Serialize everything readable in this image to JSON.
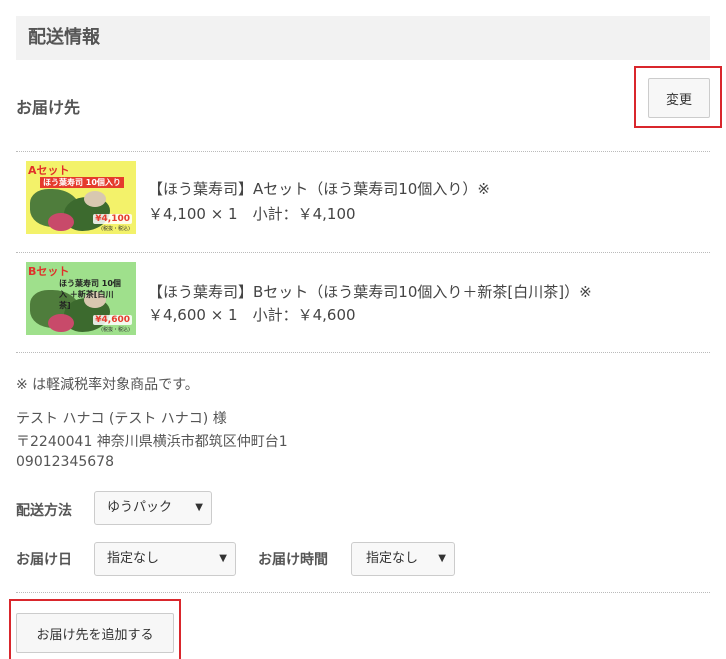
{
  "section": {
    "title": "配送情報"
  },
  "destination": {
    "title": "お届け先",
    "change_label": "変更"
  },
  "products": [
    {
      "name": "【ほう葉寿司】Aセット（ほう葉寿司10個入り）※",
      "price_line": "￥4,100 × 1　小計：￥4,100",
      "thumb": {
        "badge": "Aセット",
        "name_tag": "ほう葉寿司 10個入り",
        "price_tag": "¥4,100",
        "tax_tag": "(税抜・税込)",
        "bg": "#f3f26a"
      }
    },
    {
      "name": "【ほう葉寿司】Bセット（ほう葉寿司10個入り＋新茶[白川茶]）※",
      "price_line": "￥4,600 × 1　小計：￥4,600",
      "thumb": {
        "badge": "Bセット",
        "name_tag": "ほう葉寿司 10個入 ＋新茶[白川茶]",
        "price_tag": "¥4,600",
        "tax_tag": "(税抜・税込)",
        "bg": "#9fe08c"
      }
    }
  ],
  "note": "※ は軽減税率対象商品です。",
  "address": {
    "name": "テスト ハナコ (テスト ハナコ) 様",
    "postal_address": "〒2240041 神奈川県横浜市都筑区仲町台1",
    "phone": "09012345678"
  },
  "shipping": {
    "method_label": "配送方法",
    "method_value": "ゆうパック",
    "date_label": "お届け日",
    "date_value": "指定なし",
    "time_label": "お届け時間",
    "time_value": "指定なし"
  },
  "add_destination_label": "お届け先を追加する",
  "colors": {
    "highlight": "#d9262c",
    "header_bg": "#f2f2f2"
  },
  "icons": {
    "select_arrow": "chevron-down-icon"
  }
}
